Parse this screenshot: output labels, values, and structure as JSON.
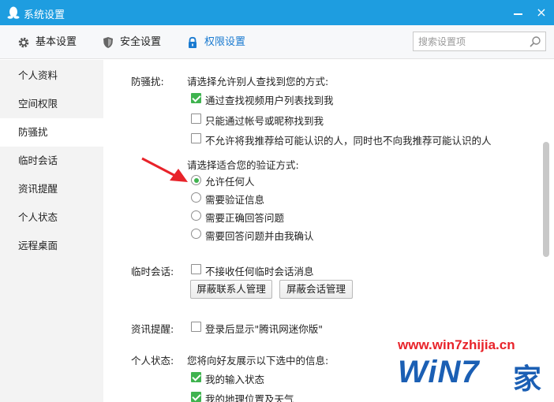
{
  "window": {
    "title": "系统设置",
    "close_glyph": "×"
  },
  "tabs": [
    {
      "label": "基本设置",
      "icon": "gear-icon",
      "active": false
    },
    {
      "label": "安全设置",
      "icon": "shield-icon",
      "active": false
    },
    {
      "label": "权限设置",
      "icon": "lock-icon",
      "active": true
    }
  ],
  "search": {
    "placeholder": "搜索设置项"
  },
  "sidebar": {
    "items": [
      {
        "label": "个人资料"
      },
      {
        "label": "空间权限"
      },
      {
        "label": "防骚扰",
        "active": true
      },
      {
        "label": "临时会话"
      },
      {
        "label": "资讯提醒"
      },
      {
        "label": "个人状态"
      },
      {
        "label": "远程桌面"
      }
    ]
  },
  "harassment": {
    "label": "防骚扰:",
    "find_prompt": "请选择允许别人查找到您的方式:",
    "find_options": [
      {
        "label": "通过查找视频用户列表找到我",
        "checked": true
      },
      {
        "label": "只能通过帐号或昵称找到我",
        "checked": false
      },
      {
        "label": "不允许将我推荐给可能认识的人，同时也不向我推荐可能认识的人",
        "checked": false
      }
    ],
    "verify_prompt": "请选择适合您的验证方式:",
    "verify_options": [
      {
        "label": "允许任何人",
        "selected": true
      },
      {
        "label": "需要验证信息",
        "selected": false
      },
      {
        "label": "需要正确回答问题",
        "selected": false
      },
      {
        "label": "需要回答问题并由我确认",
        "selected": false
      }
    ]
  },
  "temp_session": {
    "label": "临时会话:",
    "option": {
      "label": "不接收任何临时会话消息",
      "checked": false
    },
    "buttons": {
      "block_contacts": "屏蔽联系人管理",
      "block_sessions": "屏蔽会话管理"
    }
  },
  "news": {
    "label": "资讯提醒:",
    "option": {
      "label": "登录后显示\"腾讯网迷你版\"",
      "checked": false
    }
  },
  "status": {
    "label": "个人状态:",
    "prompt": "您将向好友展示以下选中的信息:",
    "options": [
      {
        "label": "我的输入状态",
        "checked": true
      },
      {
        "label": "我的地理位置及天气",
        "checked": true
      }
    ]
  },
  "watermark": {
    "url": "www.win7zhijia.cn",
    "logo": "WiN7",
    "logo_suffix": "家"
  },
  "colors": {
    "titlebar": "#1e9de0",
    "accent": "#1a7ad0",
    "check": "#3fb34f",
    "arrow": "#e8232a"
  }
}
